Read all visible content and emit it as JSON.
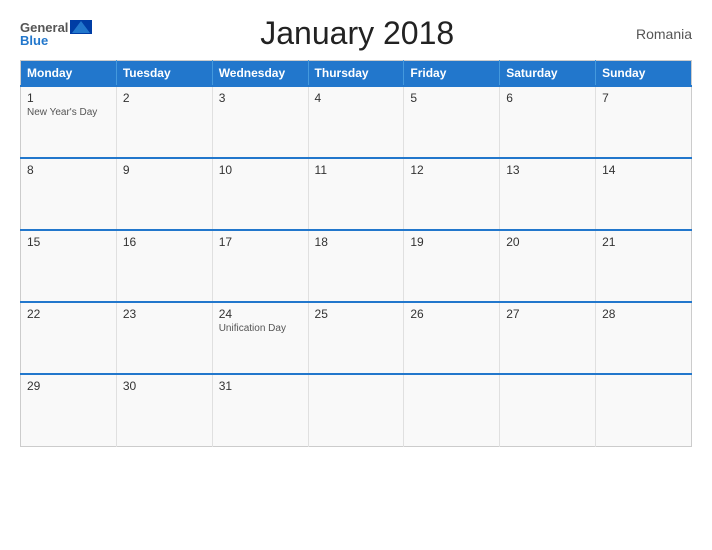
{
  "header": {
    "logo_general": "General",
    "logo_blue": "Blue",
    "title": "January 2018",
    "country": "Romania"
  },
  "days_of_week": [
    "Monday",
    "Tuesday",
    "Wednesday",
    "Thursday",
    "Friday",
    "Saturday",
    "Sunday"
  ],
  "weeks": [
    [
      {
        "day": "1",
        "holiday": "New Year's Day"
      },
      {
        "day": "2",
        "holiday": ""
      },
      {
        "day": "3",
        "holiday": ""
      },
      {
        "day": "4",
        "holiday": ""
      },
      {
        "day": "5",
        "holiday": ""
      },
      {
        "day": "6",
        "holiday": ""
      },
      {
        "day": "7",
        "holiday": ""
      }
    ],
    [
      {
        "day": "8",
        "holiday": ""
      },
      {
        "day": "9",
        "holiday": ""
      },
      {
        "day": "10",
        "holiday": ""
      },
      {
        "day": "11",
        "holiday": ""
      },
      {
        "day": "12",
        "holiday": ""
      },
      {
        "day": "13",
        "holiday": ""
      },
      {
        "day": "14",
        "holiday": ""
      }
    ],
    [
      {
        "day": "15",
        "holiday": ""
      },
      {
        "day": "16",
        "holiday": ""
      },
      {
        "day": "17",
        "holiday": ""
      },
      {
        "day": "18",
        "holiday": ""
      },
      {
        "day": "19",
        "holiday": ""
      },
      {
        "day": "20",
        "holiday": ""
      },
      {
        "day": "21",
        "holiday": ""
      }
    ],
    [
      {
        "day": "22",
        "holiday": ""
      },
      {
        "day": "23",
        "holiday": ""
      },
      {
        "day": "24",
        "holiday": "Unification Day"
      },
      {
        "day": "25",
        "holiday": ""
      },
      {
        "day": "26",
        "holiday": ""
      },
      {
        "day": "27",
        "holiday": ""
      },
      {
        "day": "28",
        "holiday": ""
      }
    ],
    [
      {
        "day": "29",
        "holiday": ""
      },
      {
        "day": "30",
        "holiday": ""
      },
      {
        "day": "31",
        "holiday": ""
      },
      {
        "day": "",
        "holiday": ""
      },
      {
        "day": "",
        "holiday": ""
      },
      {
        "day": "",
        "holiday": ""
      },
      {
        "day": "",
        "holiday": ""
      }
    ]
  ],
  "colors": {
    "header_bg": "#2277cc",
    "accent": "#2277cc"
  }
}
